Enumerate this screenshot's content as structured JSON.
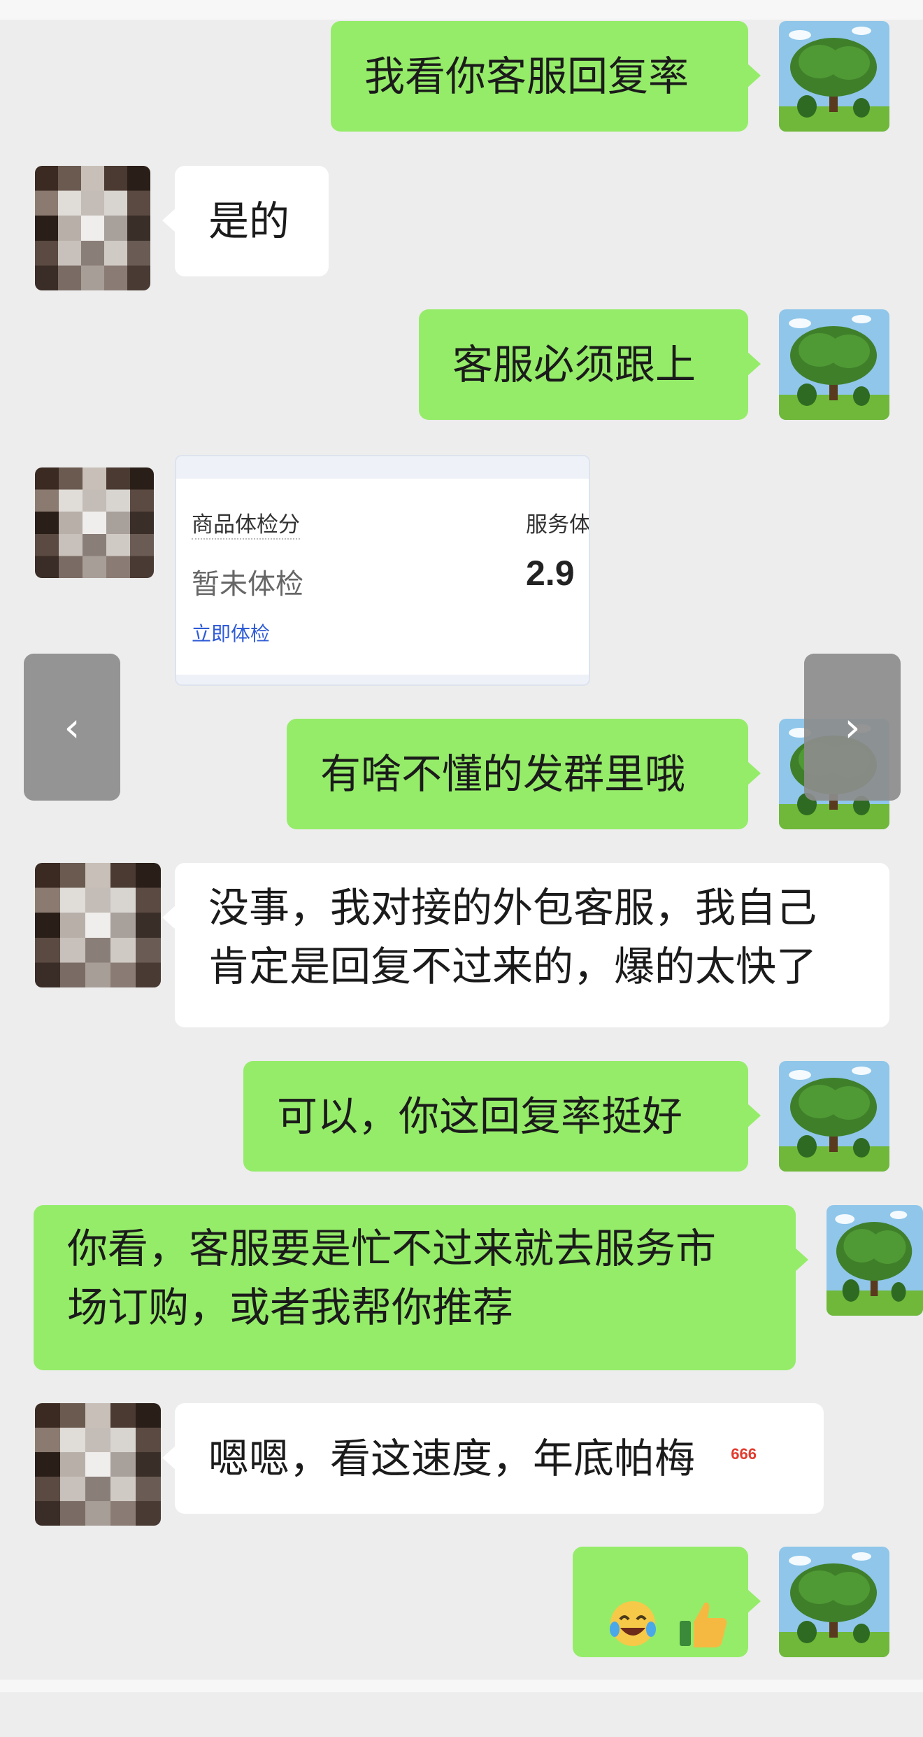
{
  "messages": [
    {
      "text": "我看你客服回复率"
    },
    {
      "text": "是的"
    },
    {
      "text": "客服必须跟上"
    },
    {
      "card": {
        "product_score_label": "商品体检分",
        "product_score_value": "暂未体检",
        "product_action": "立即体检",
        "service_score_label": "服务体",
        "service_score_value": "2.9"
      }
    },
    {
      "text": "有啥不懂的发群里哦"
    },
    {
      "text": "没事，我对接的外包客服，我自己\n肯定是回复不过来的，爆的太快了"
    },
    {
      "text": "可以，你这回复率挺好"
    },
    {
      "text": "你看，客服要是忙不过来就去服务市\n场订购，或者我帮你推荐"
    },
    {
      "text": "嗯嗯，看这速度，年底帕梅",
      "emoji_badge": "666"
    },
    {
      "emojis": [
        "tears-of-joy-icon",
        "thumbs-up-icon"
      ]
    }
  ],
  "nav": {
    "prev": "‹",
    "next": "›"
  },
  "colors": {
    "background": "#ededed",
    "my_bubble": "#95ec69",
    "their_bubble": "#ffffff",
    "link": "#2f5bd6"
  }
}
